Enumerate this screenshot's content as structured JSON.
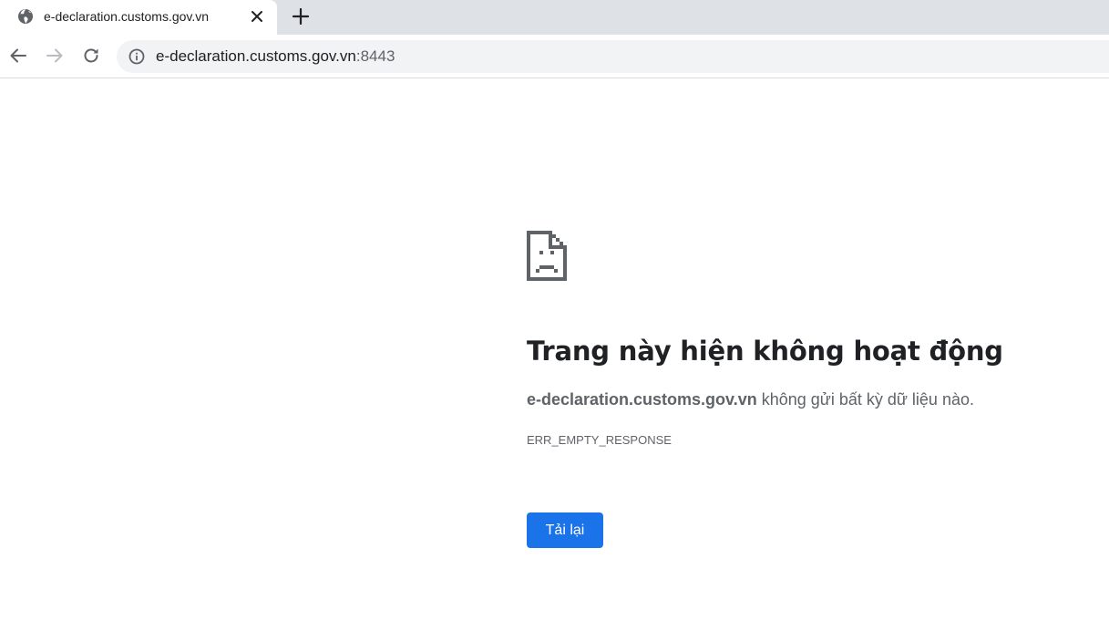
{
  "browser": {
    "tab": {
      "title": "e-declaration.customs.gov.vn",
      "favicon": "globe-icon"
    },
    "omnibox": {
      "host": "e-declaration.customs.gov.vn",
      "port": ":8443",
      "security_icon": "info-icon"
    },
    "icons": {
      "back": "arrow-left-icon",
      "forward": "arrow-right-icon",
      "reload": "reload-icon",
      "close_tab": "close-icon",
      "new_tab": "plus-icon"
    }
  },
  "error_page": {
    "icon": "sad-page-icon",
    "title": "Trang này hiện không hoạt động",
    "description_host": "e-declaration.customs.gov.vn",
    "description_rest": " không gửi bất kỳ dữ liệu nào.",
    "error_code": "ERR_EMPTY_RESPONSE",
    "reload_label": "Tải lại"
  },
  "colors": {
    "accent": "#1a73e8",
    "tabstrip_bg": "#dee1e6",
    "omnibox_bg": "#f1f3f4",
    "text_primary": "#202124",
    "text_secondary": "#5f6368"
  }
}
